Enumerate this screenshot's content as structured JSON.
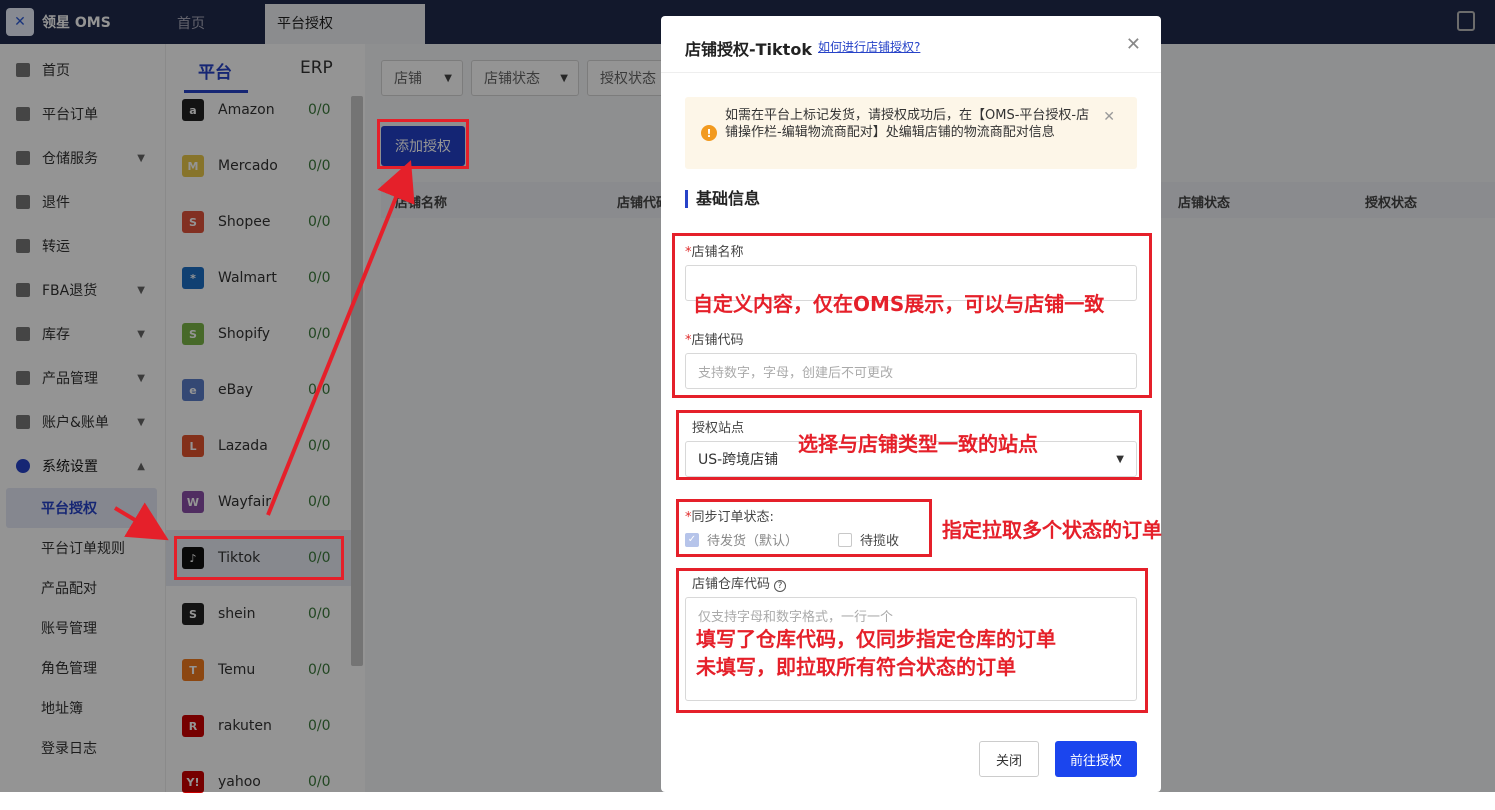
{
  "topbar": {
    "brand": "领星 OMS",
    "tabs": [
      "首页",
      "平台授权"
    ]
  },
  "leftnav": {
    "items": [
      {
        "label": "首页",
        "chevron": false
      },
      {
        "label": "平台订单",
        "chevron": false
      },
      {
        "label": "仓储服务",
        "chevron": true
      },
      {
        "label": "退件",
        "chevron": false
      },
      {
        "label": "转运",
        "chevron": false
      },
      {
        "label": "FBA退货",
        "chevron": true
      },
      {
        "label": "库存",
        "chevron": true
      },
      {
        "label": "产品管理",
        "chevron": true
      },
      {
        "label": "账户&账单",
        "chevron": true
      }
    ],
    "section": "系统设置",
    "sub_items": [
      "平台授权",
      "平台订单规则",
      "产品配对",
      "账号管理",
      "角色管理",
      "地址簿",
      "登录日志"
    ]
  },
  "platforms": {
    "tabs": [
      "平台",
      "ERP"
    ],
    "items": [
      {
        "name": "Amazon",
        "count": "0/0",
        "icon": "a",
        "color": "#222"
      },
      {
        "name": "Mercado",
        "count": "0/0",
        "icon": "M",
        "color": "#e8c84a"
      },
      {
        "name": "Shopee",
        "count": "0/0",
        "icon": "S",
        "color": "#e0533c"
      },
      {
        "name": "Walmart",
        "count": "0/0",
        "icon": "*",
        "color": "#1d6fc4"
      },
      {
        "name": "Shopify",
        "count": "0/0",
        "icon": "S",
        "color": "#7ab648"
      },
      {
        "name": "eBay",
        "count": "0/0",
        "icon": "e",
        "color": "#5b7cc8"
      },
      {
        "name": "Lazada",
        "count": "0/0",
        "icon": "L",
        "color": "#e2542e"
      },
      {
        "name": "Wayfair",
        "count": "0/0",
        "icon": "W",
        "color": "#8a4fa8"
      },
      {
        "name": "Tiktok",
        "count": "0/0",
        "icon": "♪",
        "color": "#111"
      },
      {
        "name": "shein",
        "count": "0/0",
        "icon": "S",
        "color": "#222"
      },
      {
        "name": "Temu",
        "count": "0/0",
        "icon": "T",
        "color": "#f27a1e"
      },
      {
        "name": "rakuten",
        "count": "0/0",
        "icon": "R",
        "color": "#c00"
      },
      {
        "name": "yahoo",
        "count": "0/0",
        "icon": "Y!",
        "color": "#c00"
      }
    ]
  },
  "main": {
    "filters": [
      "店铺",
      "店铺状态",
      "授权状态"
    ],
    "add_button": "添加授权",
    "columns": [
      "店铺名称",
      "店铺代码",
      "店铺状态",
      "授权状态"
    ]
  },
  "modal": {
    "title": "店铺授权-Tiktok",
    "help_link": "如何进行店铺授权?",
    "alert": "如需在平台上标记发货，请授权成功后，在【OMS-平台授权-店铺操作栏-编辑物流商配对】处编辑店铺的物流商配对信息",
    "section": "基础信息",
    "store_name_label": "店铺名称",
    "store_name_value": "",
    "store_code_label": "店铺代码",
    "store_code_placeholder": "支持数字，字母，创建后不可更改",
    "site_label": "授权站点",
    "site_value": "US-跨境店铺",
    "sync_label": "同步订单状态:",
    "sync_options": [
      {
        "label": "待发货（默认）",
        "checked": true
      },
      {
        "label": "待揽收",
        "checked": false
      }
    ],
    "warehouse_label": "店铺仓库代码",
    "warehouse_placeholder": "仅支持字母和数字格式，一行一个",
    "close_button": "关闭",
    "submit_button": "前往授权"
  },
  "annotations": {
    "name_note": "自定义内容，仅在OMS展示，可以与店铺一致",
    "site_note": "选择与店铺类型一致的站点",
    "sync_note": "指定拉取多个状态的订单",
    "warehouse_note_1": "填写了仓库代码，仅同步指定仓库的订单",
    "warehouse_note_2": "未填写，即拉取所有符合状态的订单"
  }
}
